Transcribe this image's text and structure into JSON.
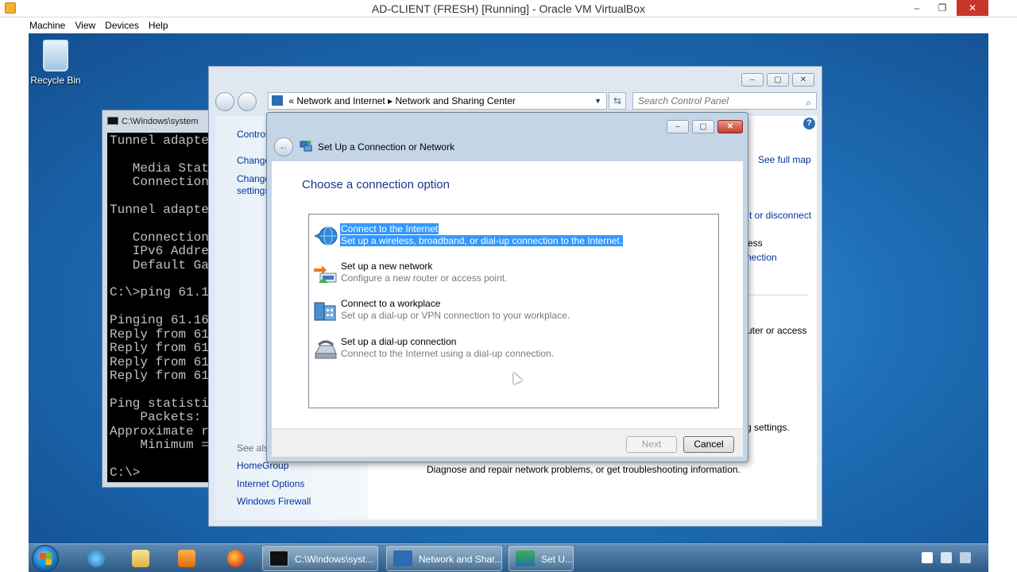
{
  "vbox": {
    "title": "AD-CLIENT (FRESH) [Running] - Oracle VM VirtualBox",
    "menu": [
      "Machine",
      "View",
      "Devices",
      "Help"
    ],
    "controls": {
      "minimize": "–",
      "restore": "❐",
      "close": "✕"
    }
  },
  "desktop": {
    "recycle_bin_label": "Recycle Bin"
  },
  "cmd": {
    "title": "C:\\Windows\\system",
    "lines": [
      "Tunnel adapte",
      "",
      "   Media Stat",
      "   Connection",
      "",
      "Tunnel adapte",
      "",
      "   Connection",
      "   IPv6 Addre",
      "   Default Ga",
      "",
      "C:\\>ping 61.1",
      "",
      "Pinging 61.16",
      "Reply from 61",
      "Reply from 61",
      "Reply from 61",
      "Reply from 61",
      "",
      "Ping statisti",
      "    Packets:",
      "Approximate r",
      "    Minimum =",
      "",
      "C:\\>"
    ]
  },
  "nsc": {
    "breadcrumb_prefix": "«",
    "breadcrumb": [
      "Network and Internet",
      "Network and Sharing Center"
    ],
    "crumb_separator": "▸",
    "search_placeholder": "Search Control Panel",
    "left_pane": {
      "control_panel_home": "Control",
      "change_1": "Change",
      "change_2": "Change",
      "settings": "settings",
      "see_also": "See also",
      "links": [
        "HomeGroup",
        "Internet Options",
        "Windows Firewall"
      ]
    },
    "content": {
      "see_full_map": "See full map",
      "connect_or_disconnect": "t or disconnect",
      "access": "ess",
      "nection": "nection",
      "router_or_access": "uter or access",
      "settings_tail": "g settings.",
      "troubleshoot_desc": "Diagnose and repair network problems, or get troubleshooting information."
    }
  },
  "dialog": {
    "title": "Set Up a Connection or Network",
    "instruction": "Choose a connection option",
    "options": [
      {
        "title": "Connect to the Internet",
        "desc": "Set up a wireless, broadband, or dial-up connection to the Internet.",
        "icon": "globe-icon",
        "selected": true
      },
      {
        "title": "Set up a new network",
        "desc": "Configure a new router or access point.",
        "icon": "router-icon",
        "selected": false
      },
      {
        "title": "Connect to a workplace",
        "desc": "Set up a dial-up or VPN connection to your workplace.",
        "icon": "workplace-icon",
        "selected": false
      },
      {
        "title": "Set up a dial-up connection",
        "desc": "Connect to the Internet using a dial-up connection.",
        "icon": "phone-icon",
        "selected": false
      }
    ],
    "next_label": "Next",
    "cancel_label": "Cancel"
  },
  "taskbar": {
    "tasks": [
      {
        "label": "C:\\Windows\\syst...",
        "icon": "cmd-icon"
      },
      {
        "label": "Network and Shar...",
        "icon": "network-icon"
      },
      {
        "label": "Set U...",
        "icon": "setup-network-icon"
      }
    ]
  },
  "colors": {
    "selection": "#3399ff",
    "link": "#003399",
    "instruction": "#1e3287",
    "desktop": "#1f6fb8"
  }
}
